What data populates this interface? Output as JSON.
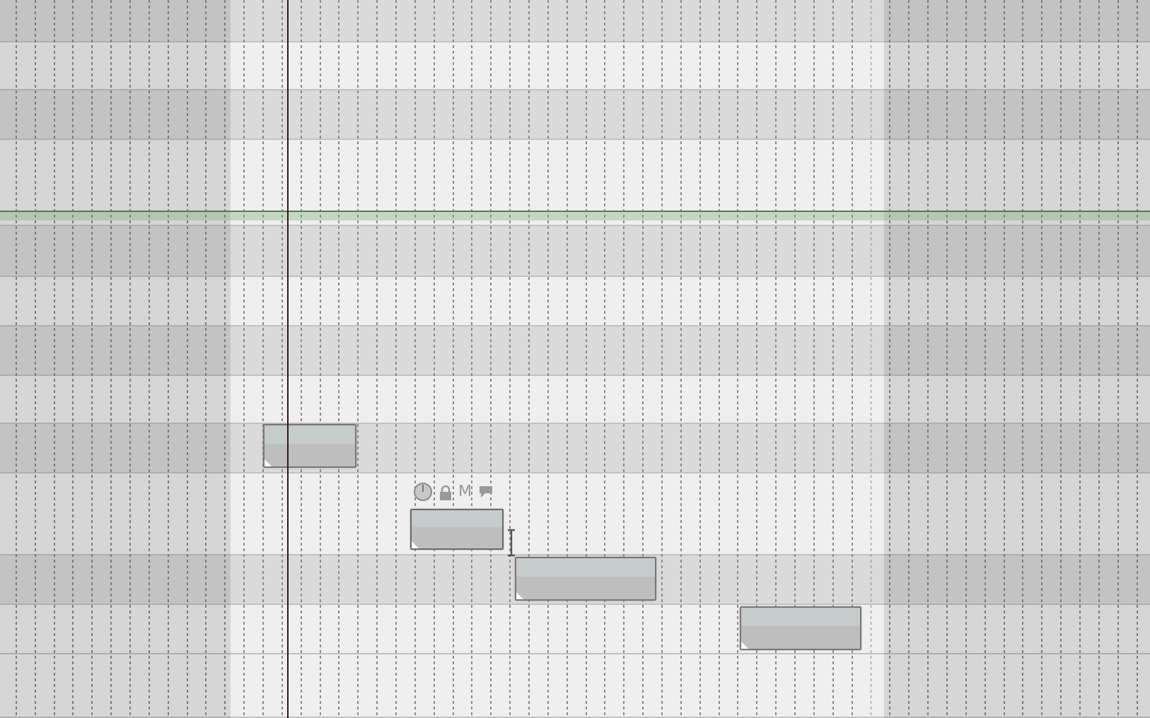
{
  "lanes": [
    {
      "kind": "black"
    },
    {
      "kind": "white"
    },
    {
      "kind": "black"
    },
    {
      "kind": "white"
    },
    {
      "kind": "black"
    },
    {
      "kind": "white"
    },
    {
      "kind": "black"
    },
    {
      "kind": "white"
    },
    {
      "kind": "black"
    },
    {
      "kind": "white"
    },
    {
      "kind": "black"
    },
    {
      "kind": "white"
    },
    {
      "kind": "white"
    }
  ],
  "notes": [
    {
      "selected": false
    },
    {
      "selected": true
    },
    {
      "selected": false
    },
    {
      "selected": false
    }
  ],
  "note_toolbar": {
    "mute_label": "M"
  }
}
